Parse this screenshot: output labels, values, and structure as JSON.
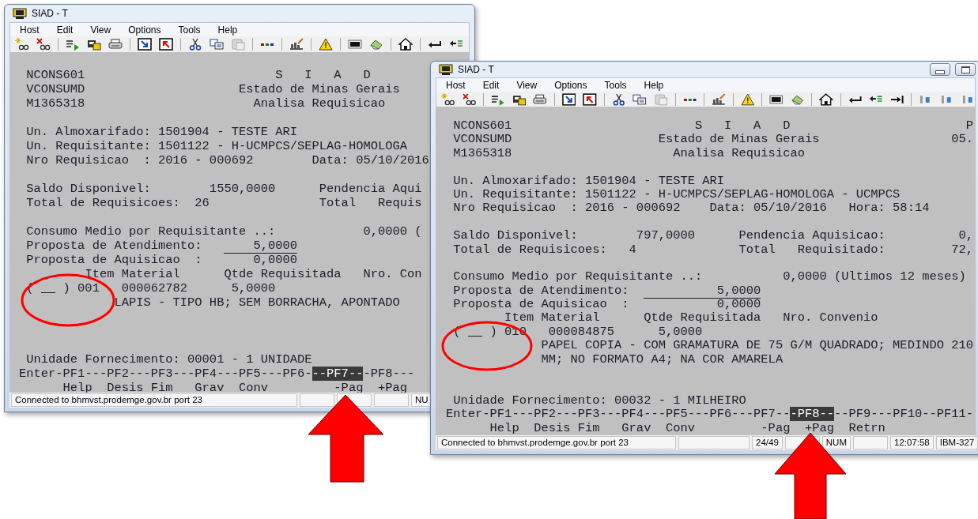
{
  "windows": [
    {
      "title": "SIAD - T",
      "caption_buttons": false,
      "menu": [
        "Host",
        "Edit",
        "View",
        "Options",
        "Tools",
        "Help"
      ],
      "screen_lines": [
        {
          "kind": "text",
          "segments": [
            {
              "kind": "text",
              "text": " NCONS601                          S   I   A   D"
            }
          ]
        },
        {
          "kind": "text",
          "segments": [
            {
              "kind": "text",
              "text": " VCONSUMD                     Estado de Minas Gerais"
            }
          ]
        },
        {
          "kind": "text",
          "segments": [
            {
              "kind": "text",
              "text": " M1365318                       Analisa Requisicao"
            }
          ]
        },
        {
          "kind": "blank"
        },
        {
          "kind": "text",
          "segments": [
            {
              "kind": "text",
              "text": " Un. Almoxarifado: 1501904 - TESTE ARI"
            }
          ]
        },
        {
          "kind": "text",
          "segments": [
            {
              "kind": "text",
              "text": " Un. Requisitante: 1501122 - H-UCMPCS/SEPLAG-HOMOLOGA"
            }
          ]
        },
        {
          "kind": "text",
          "segments": [
            {
              "kind": "text",
              "text": " Nro Requisicao  : 2016 - 000692        Data: 05/10/2016"
            }
          ]
        },
        {
          "kind": "blank"
        },
        {
          "kind": "text",
          "segments": [
            {
              "kind": "text",
              "text": " Saldo Disponivel:        1550,0000      Pendencia Aqui"
            }
          ]
        },
        {
          "kind": "text",
          "segments": [
            {
              "kind": "text",
              "text": " Total de Requisicoes:  26               Total   Requis"
            }
          ]
        },
        {
          "kind": "blank"
        },
        {
          "kind": "text",
          "segments": [
            {
              "kind": "text",
              "text": " Consumo Medio por Requisitante ..:            0,0000 ("
            }
          ]
        },
        {
          "kind": "text",
          "segments": [
            {
              "kind": "text",
              "text": " Proposta de Atendimento:   "
            },
            {
              "kind": "field",
              "text": "    5,0000"
            }
          ]
        },
        {
          "kind": "text",
          "segments": [
            {
              "kind": "text",
              "text": " Proposta de Aquisicao  :       0,0000"
            }
          ]
        },
        {
          "kind": "text",
          "segments": [
            {
              "kind": "text",
              "text": "         Item Material      Qtde Requisitada   Nro. Con"
            }
          ]
        },
        {
          "kind": "text",
          "segments": [
            {
              "kind": "text",
              "text": " ( "
            },
            {
              "kind": "field"
            },
            {
              "kind": "text",
              "text": " ) 001   000062782      5,0000"
            }
          ]
        },
        {
          "kind": "text",
          "segments": [
            {
              "kind": "text",
              "text": "             LAPIS - TIPO HB; SEM BORRACHA, APONTADO"
            }
          ]
        },
        {
          "kind": "blank"
        },
        {
          "kind": "blank"
        },
        {
          "kind": "blank"
        },
        {
          "kind": "text",
          "segments": [
            {
              "kind": "text",
              "text": " Unidade Fornecimento: 00001 - 1 UNIDADE"
            }
          ]
        },
        {
          "kind": "text",
          "segments": [
            {
              "kind": "text",
              "text": "Enter-PF1---PF2---PF3---PF4---PF5---PF6-"
            },
            {
              "kind": "highlight",
              "text": "--PF7--"
            },
            {
              "kind": "text",
              "text": "-PF8---"
            }
          ]
        },
        {
          "kind": "text",
          "segments": [
            {
              "kind": "text",
              "text": "      Help  Desis Fim   Grav  Conv         -Pag  +Pag"
            }
          ]
        }
      ],
      "status_bar": [
        {
          "kind": "text",
          "text": "Connected to bhmvst.prodemge.gov.br port 23"
        },
        {
          "kind": "empty"
        },
        {
          "kind": "empty"
        },
        {
          "kind": "empty"
        },
        {
          "kind": "text",
          "text": "NU"
        }
      ]
    },
    {
      "title": "SIAD - T",
      "caption_buttons": true,
      "menu": [
        "Host",
        "Edit",
        "View",
        "Options",
        "Tools",
        "Help"
      ],
      "screen_lines": [
        {
          "kind": "text",
          "segments": [
            {
              "kind": "text",
              "text": " NCONS601                         S   I   A   D                        P"
            }
          ]
        },
        {
          "kind": "text",
          "segments": [
            {
              "kind": "text",
              "text": " VCONSUMD                    Estado de Minas Gerais                  05."
            }
          ]
        },
        {
          "kind": "text",
          "segments": [
            {
              "kind": "text",
              "text": " M1365318                      Analisa Requisicao"
            }
          ]
        },
        {
          "kind": "blank"
        },
        {
          "kind": "text",
          "segments": [
            {
              "kind": "text",
              "text": " Un. Almoxarifado: 1501904 - TESTE ARI"
            }
          ]
        },
        {
          "kind": "text",
          "segments": [
            {
              "kind": "text",
              "text": " Un. Requisitante: 1501122 - H-UCMPCS/SEPLAG-HOMOLOGA - UCMPCS"
            }
          ]
        },
        {
          "kind": "text",
          "segments": [
            {
              "kind": "text",
              "text": " Nro Requisicao  : 2016 - 000692    Data: 05/10/2016   Hora: 58:14"
            }
          ]
        },
        {
          "kind": "blank"
        },
        {
          "kind": "text",
          "segments": [
            {
              "kind": "text",
              "text": " Saldo Disponivel:        797,0000      Pendencia Aquisicao:          0,"
            }
          ]
        },
        {
          "kind": "text",
          "segments": [
            {
              "kind": "text",
              "text": " Total de Requisicoes:   4              Total   Requisitado:         72,"
            }
          ]
        },
        {
          "kind": "blank"
        },
        {
          "kind": "text",
          "segments": [
            {
              "kind": "text",
              "text": " Consumo Medio por Requisitante ..:           0,0000 (Ultimos 12 meses)"
            }
          ]
        },
        {
          "kind": "text",
          "segments": [
            {
              "kind": "text",
              "text": " Proposta de Atendimento:  "
            },
            {
              "kind": "field",
              "text": "          5,0000"
            }
          ]
        },
        {
          "kind": "text",
          "segments": [
            {
              "kind": "text",
              "text": " Proposta de Aquisicao  :            0,0000"
            }
          ]
        },
        {
          "kind": "text",
          "segments": [
            {
              "kind": "text",
              "text": "        Item Material      Qtde Requisitada   Nro. Convenio"
            }
          ]
        },
        {
          "kind": "text",
          "segments": [
            {
              "kind": "text",
              "text": " ( "
            },
            {
              "kind": "field"
            },
            {
              "kind": "text",
              "text": " ) 010   000084875      5,0000"
            }
          ]
        },
        {
          "kind": "text",
          "segments": [
            {
              "kind": "text",
              "text": "             PAPEL COPIA - COM GRAMATURA DE 75 G/M QUADRADO; MEDINDO 210"
            }
          ]
        },
        {
          "kind": "text",
          "segments": [
            {
              "kind": "text",
              "text": "             MM; NO FORMATO A4; NA COR AMARELA"
            }
          ]
        },
        {
          "kind": "blank"
        },
        {
          "kind": "blank"
        },
        {
          "kind": "text",
          "segments": [
            {
              "kind": "text",
              "text": " Unidade Fornecimento: 00032 - 1 MILHEIRO"
            }
          ]
        },
        {
          "kind": "text",
          "segments": [
            {
              "kind": "text",
              "text": "Enter-PF1---PF2---PF3---PF4---PF5---PF6---PF7--"
            },
            {
              "kind": "highlight",
              "text": "-PF8--"
            },
            {
              "kind": "text",
              "text": "--PF9---PF10--PF11-"
            }
          ]
        },
        {
          "kind": "text",
          "segments": [
            {
              "kind": "text",
              "text": "      Help  Desis Fim   Grav  Conv         -Pag  +Pag  Retrn"
            }
          ]
        }
      ],
      "status_bar": [
        {
          "kind": "text",
          "text": "Connected to bhmvst.prodemge.gov.br port 23"
        },
        {
          "kind": "empty"
        },
        {
          "kind": "text",
          "text": "24/49"
        },
        {
          "kind": "empty"
        },
        {
          "kind": "text",
          "text": "NUM"
        },
        {
          "kind": "empty"
        },
        {
          "kind": "text",
          "text": "12:07:58"
        },
        {
          "kind": "text",
          "text": "IBM-327"
        }
      ]
    }
  ]
}
